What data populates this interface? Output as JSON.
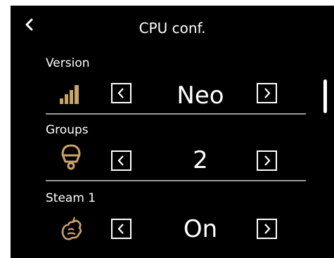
{
  "header": {
    "title": "CPU conf.",
    "back_icon": "chevron-left-icon"
  },
  "settings": [
    {
      "label": "Version",
      "value": "Neo",
      "icon": "signal-bars-icon"
    },
    {
      "label": "Groups",
      "value": "2",
      "icon": "group-head-icon"
    },
    {
      "label": "Steam 1",
      "value": "On",
      "icon": "steam-icon"
    }
  ],
  "colors": {
    "background": "#000000",
    "text": "#ffffff",
    "icon_accent": "#c9a36b",
    "divider": "#9a9a9a"
  }
}
